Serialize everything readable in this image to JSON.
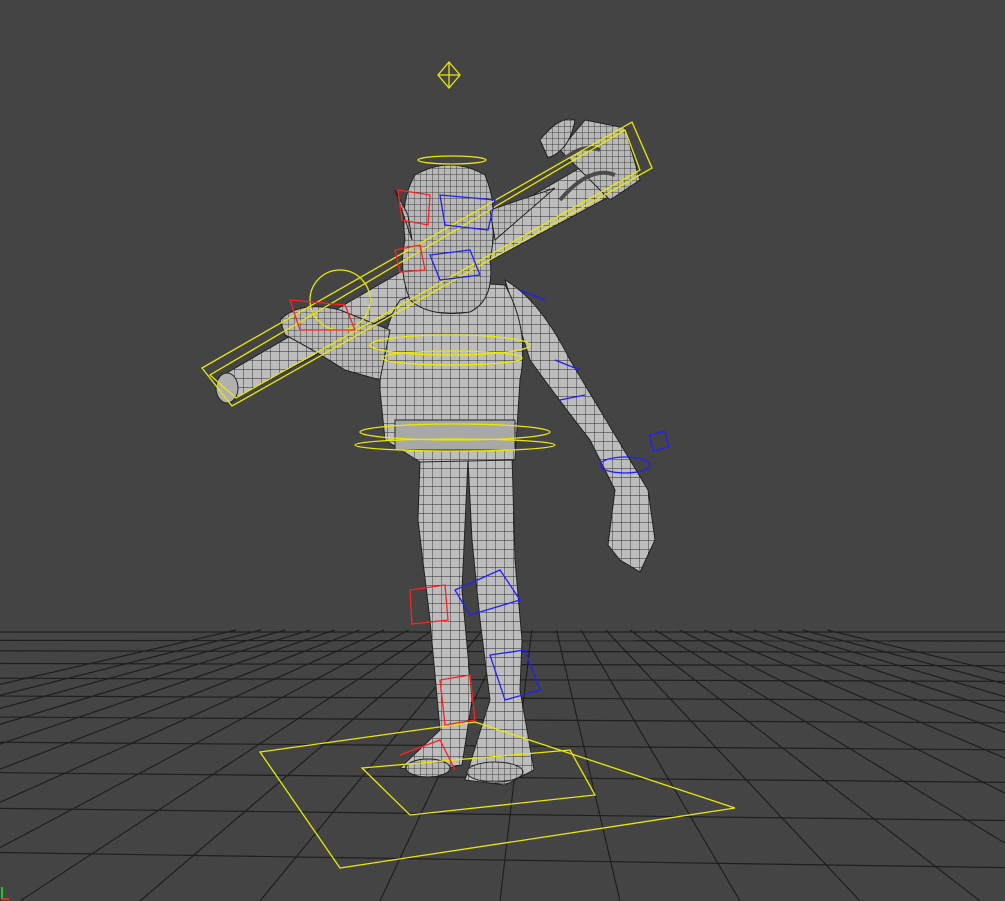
{
  "viewport": {
    "background": "#444444",
    "grid_color": "#1f1f1f",
    "mesh_fill": "#bdbdbd",
    "wire_color": "#2a2a2a",
    "control_colors": {
      "center": "#e8e800",
      "right_side": "#2020ff",
      "left_side": "#ff2020"
    },
    "axis_gizmo_color": "#00ff00"
  },
  "scene": {
    "character": "goblin-with-club",
    "controls": [
      "head-look-control",
      "club-control",
      "chest-control",
      "hip-control",
      "root-control",
      "right-arm-control",
      "left-foot-control",
      "right-foot-control"
    ]
  }
}
